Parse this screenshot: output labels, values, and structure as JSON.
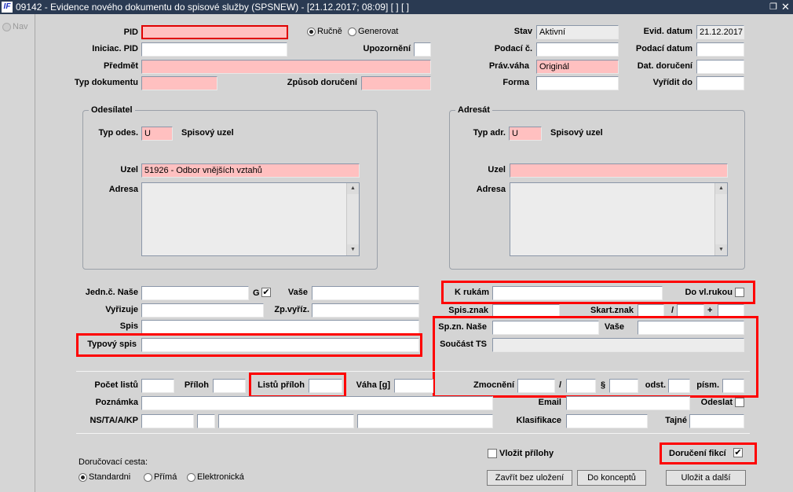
{
  "window": {
    "title": "09142 - Evidence nového dokumentu do spisové služby (SPSNEW) - [21.12.2017; 08:09]  [ ]  [ ]",
    "logo": "IF",
    "restore_icon": "restore-icon",
    "close_icon": "close-icon"
  },
  "sidebar": {
    "nav_label": "Nav"
  },
  "header": {
    "pid_label": "PID",
    "pid": "",
    "rucne": "Ručně",
    "generovat": "Generovat",
    "pid_mode": "Ručně",
    "iniciac_label": "Iniciac. PID",
    "upozorneni_label": "Upozornění",
    "predmet_label": "Předmět",
    "typ_dok_label": "Typ dokumentu",
    "zpusob_label": "Způsob doručení",
    "stav_label": "Stav",
    "stav": "Aktivní",
    "evid_label": "Evid. datum",
    "evid": "21.12.2017",
    "podaci_c_label": "Podací č.",
    "podaci_datum_label": "Podací datum",
    "prav_vaha_label": "Práv.váha",
    "prav_vaha": "Originál",
    "dat_doruceni_label": "Dat. doručení",
    "forma_label": "Forma",
    "vyridit_label": "Vyřídit do"
  },
  "odesilatel": {
    "legend": "Odesílatel",
    "typ_label": "Typ odes.",
    "typ": "U",
    "typ_text": "Spisový uzel",
    "uzel_label": "Uzel",
    "uzel": "51926 - Odbor vnějších vztahů",
    "adresa_label": "Adresa",
    "adresa": ""
  },
  "adresat": {
    "legend": "Adresát",
    "typ_label": "Typ adr.",
    "typ": "U",
    "typ_text": "Spisový uzel",
    "uzel_label": "Uzel",
    "uzel": "",
    "adresa_label": "Adresa",
    "adresa": ""
  },
  "mid": {
    "jedn_label": "Jedn.č. Naše",
    "g_label": "G",
    "g_checked": true,
    "vase_label": "Vaše",
    "vyrizuje_label": "Vyřizuje",
    "zpvyriz_label": "Zp.vyříz.",
    "spis_label": "Spis",
    "typovy_label": "Typový spis",
    "krukam_label": "K rukám",
    "dovl_label": "Do vl.rukou",
    "dovl_checked": false,
    "spisznak_label": "Spis.znak",
    "skart_label": "Skart.znak",
    "slash": "/",
    "plus": "+",
    "spzn_label": "Sp.zn. Naše",
    "spzn_vase_label": "Vaše",
    "soucast_label": "Součást TS"
  },
  "lower": {
    "pocet_label": "Počet listů",
    "priloh_label": "Příloh",
    "listu_priloh_label": "Listů příloh",
    "vaha_label": "Váha [g]",
    "zmocneni_label": "Zmocnění",
    "slash": "/",
    "para": "§",
    "odst_label": "odst.",
    "pism_label": "písm.",
    "poznamka_label": "Poznámka",
    "email_label": "Email",
    "odeslat_label": "Odeslat",
    "odeslat_checked": false,
    "ns_label": "NS/TA/A/KP",
    "klasifikace_label": "Klasifikace",
    "tajne_label": "Tajné"
  },
  "footer": {
    "vlozit_label": "Vložit přílohy",
    "vlozit_checked": false,
    "fikci_label": "Doručení fikcí",
    "fikci_checked": true,
    "cesta_label": "Doručovací cesta:",
    "cesta_options": [
      "Standardni",
      "Přímá",
      "Elektronická"
    ],
    "cesta_selected": "Standardni",
    "btn_zavrit": "Zavřít bez uložení",
    "btn_koncept": "Do konceptů",
    "btn_ulozit": "Uložit a další"
  }
}
